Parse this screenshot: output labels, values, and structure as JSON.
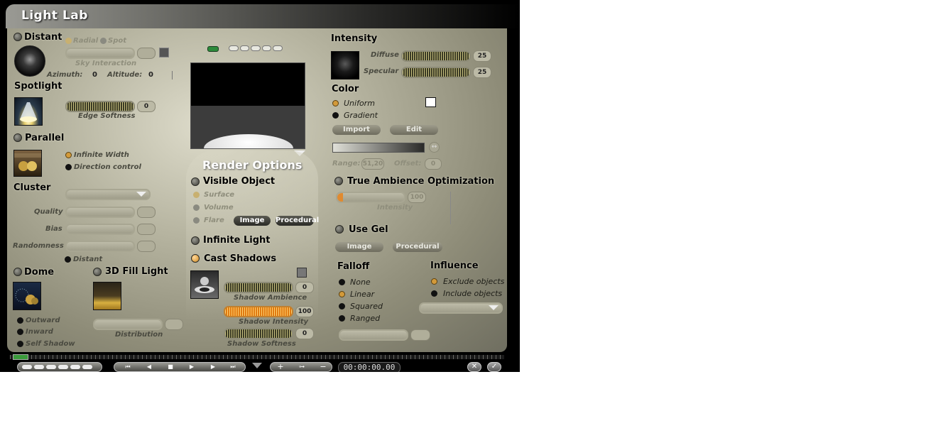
{
  "window": {
    "title": "Light  Lab"
  },
  "left": {
    "distant": {
      "label": "Distant",
      "radial": "Radial",
      "spot": "Spot",
      "sky_interaction": "Sky Interaction",
      "azimuth_label": "Azimuth:",
      "azimuth_value": "0",
      "altitude_label": "Altitude:",
      "altitude_value": "0"
    },
    "spotlight": {
      "label": "Spotlight",
      "edge_softness_value": "0",
      "edge_softness_label": "Edge Softness"
    },
    "parallel": {
      "label": "Parallel",
      "infinite_width": "Infinite Width",
      "direction_control": "Direction control"
    },
    "cluster": {
      "label": "Cluster",
      "quality": "Quality",
      "bias": "Bias",
      "randomness": "Randomness",
      "distant": "Distant"
    },
    "dome": {
      "label": "Dome",
      "outward": "Outward",
      "inward": "Inward",
      "self_shadow": "Self Shadow"
    },
    "fill": {
      "label": "3D Fill Light",
      "distribution": "Distribution"
    }
  },
  "center": {
    "render_options": "Render Options",
    "visible_object": "Visible Object",
    "surface": "Surface",
    "volume": "Volume",
    "flare": "Flare",
    "image_btn": "Image",
    "procedural_btn": "Procedural",
    "infinite_light": "Infinite Light",
    "cast_shadows": "Cast Shadows",
    "shadow_ambience_value": "0",
    "shadow_ambience_label": "Shadow Ambience",
    "shadow_intensity_value": "100",
    "shadow_intensity_label": "Shadow Intensity",
    "shadow_softness_value": "0",
    "shadow_softness_label": "Shadow Softness"
  },
  "right": {
    "intensity": "Intensity",
    "diffuse_label": "Diffuse",
    "diffuse_value": "25",
    "specular_label": "Specular",
    "specular_value": "25",
    "color": "Color",
    "uniform": "Uniform",
    "gradient": "Gradient",
    "import_btn": "Import",
    "edit_btn": "Edit",
    "range_label": "Range:",
    "range_value": "51,20",
    "offset_label": "Offset:",
    "offset_value": "0",
    "tao": "True Ambience Optimization",
    "tao_value": "100",
    "tao_intensity": "Intensity",
    "use_gel": "Use Gel",
    "gel_image": "Image",
    "gel_procedural": "Procedural",
    "falloff": "Falloff",
    "falloff_options": [
      "None",
      "Linear",
      "Squared",
      "Ranged"
    ],
    "influence": "Influence",
    "exclude": "Exclude objects",
    "include": "Include objects"
  },
  "transport": {
    "timecode": "00:00:00.00"
  },
  "colors": {
    "panel": "#b6b4a0",
    "accent": "#d39a3a"
  }
}
